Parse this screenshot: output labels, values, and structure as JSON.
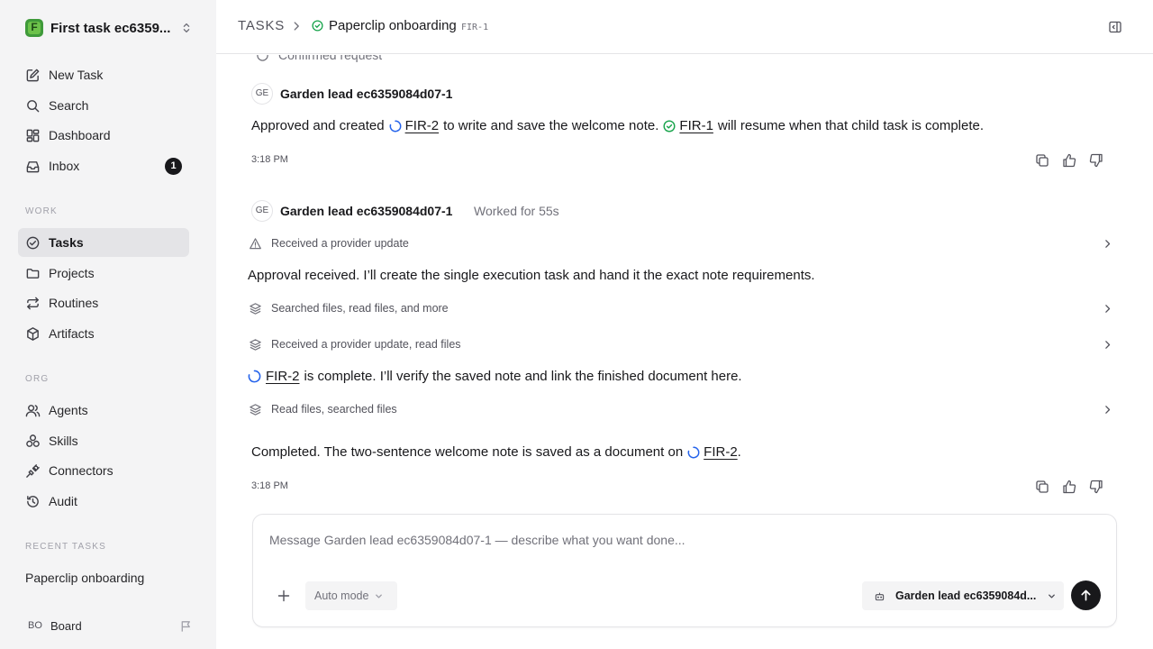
{
  "colors": {
    "accent": "#18181b",
    "done_green": "#16a34a",
    "in_progress_blue": "#2563eb",
    "sidebar_bg": "#f4f4f5"
  },
  "workspace": {
    "name": "First task ec6359...",
    "initial": "F"
  },
  "nav": {
    "top": [
      {
        "label": "New Task",
        "icon": "edit-icon"
      },
      {
        "label": "Search",
        "icon": "search-icon"
      },
      {
        "label": "Dashboard",
        "icon": "dashboard-icon"
      },
      {
        "label": "Inbox",
        "icon": "inbox-icon",
        "badge": "1"
      }
    ],
    "work_title": "WORK",
    "work": [
      {
        "label": "Tasks",
        "icon": "tasks-icon",
        "active": true
      },
      {
        "label": "Projects",
        "icon": "folder-icon"
      },
      {
        "label": "Routines",
        "icon": "repeat-icon"
      },
      {
        "label": "Artifacts",
        "icon": "box-icon"
      }
    ],
    "org_title": "ORG",
    "org": [
      {
        "label": "Agents",
        "icon": "users-icon"
      },
      {
        "label": "Skills",
        "icon": "skills-icon"
      },
      {
        "label": "Connectors",
        "icon": "plug-icon"
      },
      {
        "label": "Audit",
        "icon": "history-icon"
      }
    ],
    "recent_title": "RECENT TASKS",
    "recent": [
      "Paperclip onboarding"
    ]
  },
  "user": {
    "initials": "BO",
    "name": "Board"
  },
  "header": {
    "section": "TASKS",
    "task_title": "Paperclip onboarding",
    "task_id": "FIR-1"
  },
  "thread": {
    "partial_event": "Confirmed request",
    "messages": [
      {
        "avatar": "GE",
        "author": "Garden lead ec6359084d07-1",
        "body": {
          "p1": "Approved and created",
          "link1": "FIR-2",
          "p2": "to write and save the welcome note.",
          "link2": "FIR-1",
          "p3": "will resume when that child task is complete."
        },
        "time": "3:18 PM"
      },
      {
        "avatar": "GE",
        "author": "Garden lead ec6359084d07-1",
        "worked": "Worked for 55s",
        "event1": "Received a provider update",
        "text1": "Approval received. I’ll create the single execution task and hand it the exact note requirements.",
        "event2": "Searched files, read files, and more",
        "event3": "Received a provider update, read files",
        "text2_link": "FIR-2",
        "text2": "is complete. I’ll verify the saved note and link the finished document here.",
        "event4": "Read files, searched files",
        "final": {
          "p1": "Completed. The two-sentence welcome note is saved as a document on",
          "link": "FIR-2",
          "p2": "."
        },
        "time": "3:18 PM"
      }
    ]
  },
  "composer": {
    "placeholder": "Message Garden lead ec6359084d07-1 — describe what you want done...",
    "mode": "Auto mode",
    "agent": "Garden lead ec6359084d..."
  }
}
